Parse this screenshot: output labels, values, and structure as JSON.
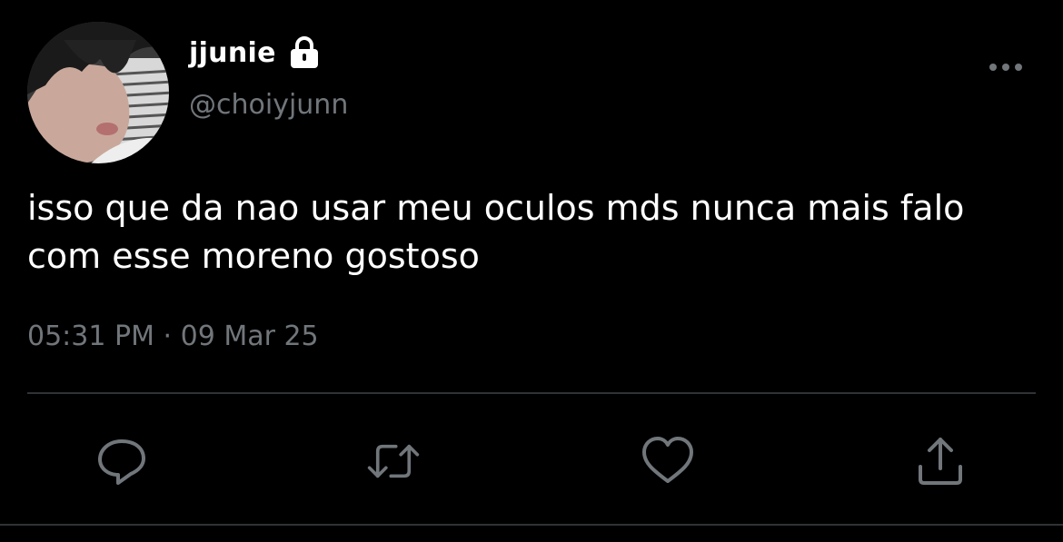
{
  "user": {
    "display_name": "jjunie",
    "handle": "@choiyjunn",
    "avatar_icon": "profile-photo",
    "lock_icon": "lock-icon"
  },
  "tweet": {
    "text": "isso que da nao usar meu oculos mds nunca mais falo\ncom esse moreno gostoso",
    "time": "05:31 PM",
    "separator": "·",
    "date": "09 Mar 25"
  },
  "actions": {
    "more_icon": "more-horizontal-icon",
    "reply_icon": "reply-icon",
    "retweet_icon": "retweet-icon",
    "like_icon": "like-icon",
    "share_icon": "share-icon"
  },
  "colors": {
    "background": "#000000",
    "text": "#ffffff",
    "secondary": "#71767b",
    "divider": "#2f3336"
  }
}
